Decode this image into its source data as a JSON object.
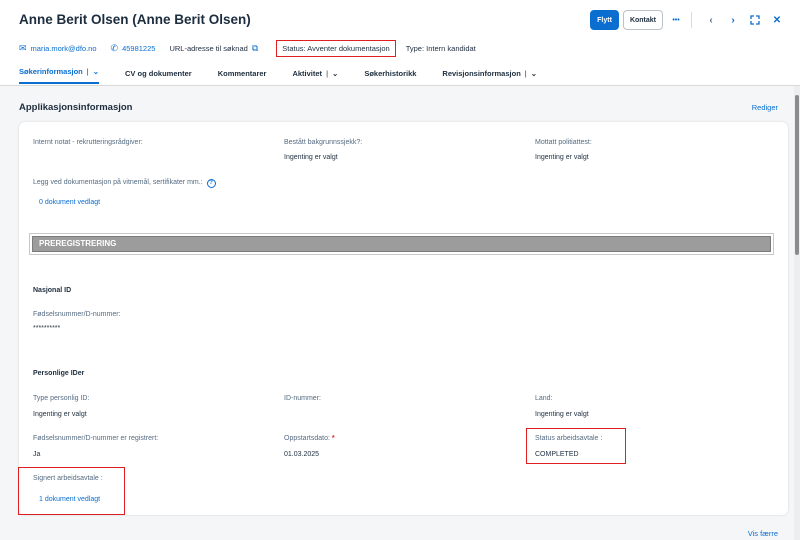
{
  "header": {
    "title": "Anne Berit Olsen (Anne Berit Olsen)",
    "actions": {
      "move": "Flytt",
      "contact": "Kontakt",
      "more": "•••"
    }
  },
  "meta": {
    "email": "maria.mork@dfo.no",
    "phone": "45981225",
    "url_label": "URL-adresse til søknad",
    "status": "Status: Avventer dokumentasjon",
    "type": "Type: Intern kandidat"
  },
  "tabs": [
    {
      "label": "Søkerinformasjon"
    },
    {
      "label": "CV og dokumenter"
    },
    {
      "label": "Kommentarer"
    },
    {
      "label": "Aktivitet"
    },
    {
      "label": "Søkerhistorikk"
    },
    {
      "label": "Revisjonsinformasjon"
    }
  ],
  "section": {
    "title": "Applikasjonsinformasjon",
    "edit": "Rediger",
    "show_less": "Vis færre"
  },
  "fields": {
    "internal_note_label": "Internt notat - rekrutteringsrådgiver:",
    "background_check_label": "Bestått bakgrunnssjekk?:",
    "background_check_value": "Ingenting er valgt",
    "police_cert_label": "Mottatt politiattest:",
    "police_cert_value": "Ingenting er valgt",
    "docs_label": "Legg ved dokumentasjon på vitnemål, sertifikater mm.:",
    "docs_value": "0 dokument vedlagt",
    "prereg": "PREREGISTRERING",
    "national_id_head": "Nasjonal ID",
    "national_id_label": "Fødselsnummer/D-nummer:",
    "national_id_value": "**********",
    "personal_ids_head": "Personlige IDer",
    "personal_id_type_label": "Type personlig ID:",
    "personal_id_type_value": "Ingenting er valgt",
    "id_number_label": "ID-nummer:",
    "country_label": "Land:",
    "country_value": "Ingenting er valgt",
    "registered_label": "Fødselsnummer/D-nummer er registrert:",
    "registered_value": "Ja",
    "start_date_label": "Oppstartsdato:",
    "start_date_value": "01.03.2025",
    "contract_status_label": "Status arbeidsavtale :",
    "contract_status_value": "COMPLETED",
    "signed_contract_label": "Signert arbeidsavtale :",
    "signed_contract_value": "1 dokument vedlagt"
  }
}
